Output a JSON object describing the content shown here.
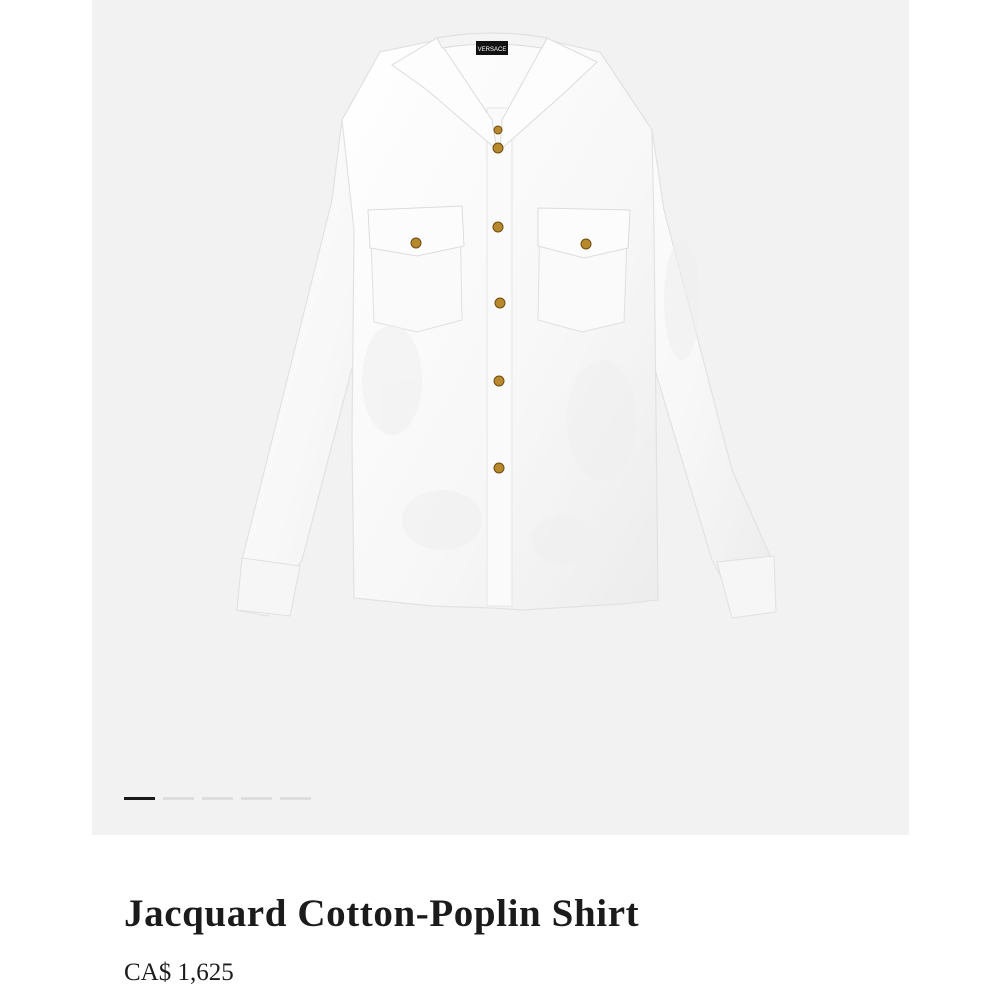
{
  "gallery": {
    "image_count": 5,
    "active_index": 0,
    "brand_label": "VERSACE"
  },
  "product": {
    "name": "Jacquard Cotton-Poplin Shirt",
    "price": "CA$ 1,625"
  },
  "colors": {
    "gallery_bg": "#f2f2f2",
    "shirt": "#fbfbfb",
    "button_gold": "#b8892c",
    "pager_active": "#1a1a1a",
    "pager_inactive": "#dedede"
  }
}
